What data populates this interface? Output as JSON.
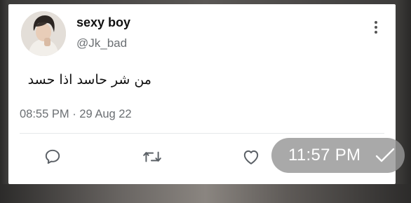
{
  "tweet": {
    "display_name": "sexy boy",
    "handle": "@Jk_bad",
    "text": "من شر حاسد اذا حسد",
    "timestamp": "08:55 PM · 29 Aug 22"
  },
  "actions": {
    "icons": [
      "reply-icon",
      "retweet-icon",
      "like-icon"
    ]
  },
  "overlay": {
    "time": "11:57 PM",
    "icon": "check-icon"
  }
}
